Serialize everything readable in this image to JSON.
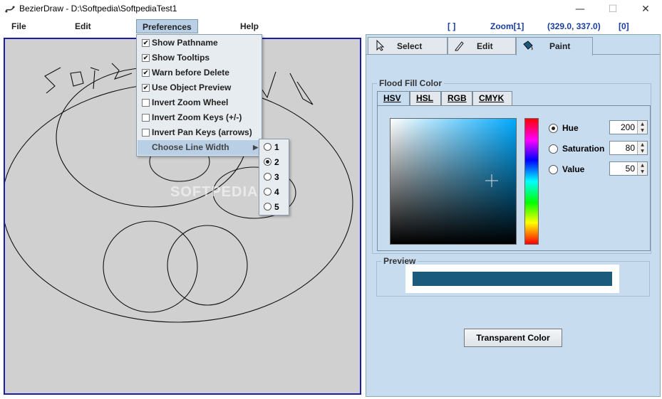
{
  "window": {
    "title": "BezierDraw - D:\\Softpedia\\SoftpediaTest1",
    "minimize": "—",
    "maximize": "☐",
    "close": "✕"
  },
  "menubar": {
    "items": [
      "File",
      "Edit",
      "Preferences",
      "Help"
    ]
  },
  "status": {
    "selection": "[ ]",
    "zoom": "Zoom[1]",
    "coords": "(329.0, 337.0)",
    "count": "[0]"
  },
  "canvas": {
    "watermark": "SOFTPEDIA",
    "background": "#d0d0d0",
    "border": "#1b1ba8"
  },
  "preferences_menu": {
    "items": [
      {
        "label": "Show Pathname",
        "checked": true
      },
      {
        "label": "Show Tooltips",
        "checked": true
      },
      {
        "label": "Warn before Delete",
        "checked": true
      },
      {
        "label": "Use Object Preview",
        "checked": true
      },
      {
        "label": "Invert Zoom Wheel",
        "checked": false
      },
      {
        "label": "Invert Zoom Keys (+/-)",
        "checked": false
      },
      {
        "label": "Invert Pan Keys (arrows)",
        "checked": false
      }
    ],
    "submenu_label": "Choose Line Width",
    "line_widths": [
      "1",
      "2",
      "3",
      "4",
      "5"
    ],
    "selected_line_width": "2"
  },
  "tool_tabs": {
    "tabs": [
      "Select",
      "Edit",
      "Paint"
    ],
    "active": "Paint"
  },
  "flood_fill": {
    "title": "Flood Fill Color",
    "model_tabs": [
      "HSV",
      "HSL",
      "RGB",
      "CMYK"
    ],
    "active_model": "HSV",
    "fields": [
      {
        "label": "Hue",
        "value": "200",
        "selected": true
      },
      {
        "label": "Saturation",
        "value": "80",
        "selected": false
      },
      {
        "label": "Value",
        "value": "50",
        "selected": false
      }
    ],
    "preview_title": "Preview",
    "preview_color": "#1a5a7d",
    "transparent_button": "Transparent Color"
  }
}
